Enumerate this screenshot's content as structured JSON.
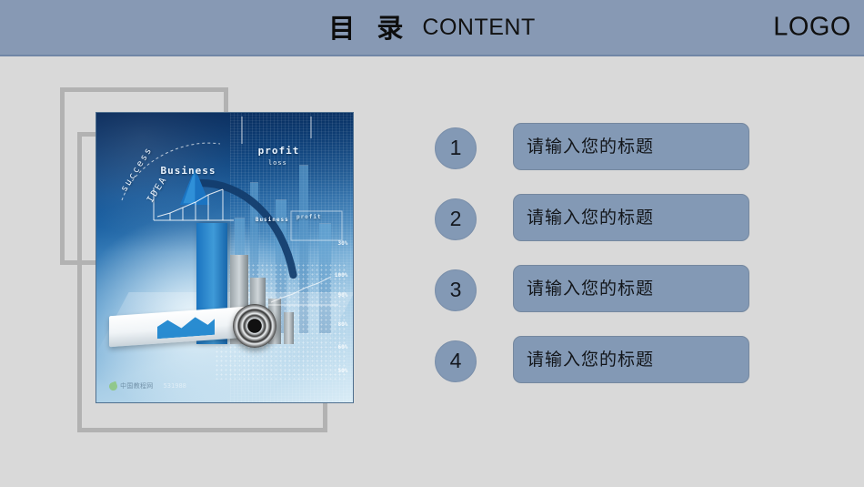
{
  "header": {
    "title_cn": "目 录",
    "title_en": "CONTENT",
    "logo": "LOGO",
    "band_color": "#8799b4",
    "band_border_color": "#7186a6"
  },
  "theme": {
    "background": "#d9d9d9",
    "accent": "#8399b5",
    "accent_border": "#75889f",
    "frame_gray": "#b2b2b2",
    "text_dark": "#121519"
  },
  "illustration": {
    "name": "business-growth-chart-photo",
    "labels": {
      "business": "Business",
      "profit": "profit",
      "loss": "loss",
      "business_small": "Business",
      "profit_small": "profit",
      "loss_small": "loss",
      "success": "success",
      "idea": "IDEA"
    },
    "percent_ticks": [
      "100%",
      "90%",
      "80%",
      "60%",
      "50%",
      "30%"
    ],
    "watermark_text": "中国教程网",
    "watermark_id": "531988"
  },
  "menu": {
    "items": [
      {
        "number": "1",
        "title": "请输入您的标题"
      },
      {
        "number": "2",
        "title": "请输入您的标题"
      },
      {
        "number": "3",
        "title": "请输入您的标题"
      },
      {
        "number": "4",
        "title": "请输入您的标题"
      }
    ]
  }
}
